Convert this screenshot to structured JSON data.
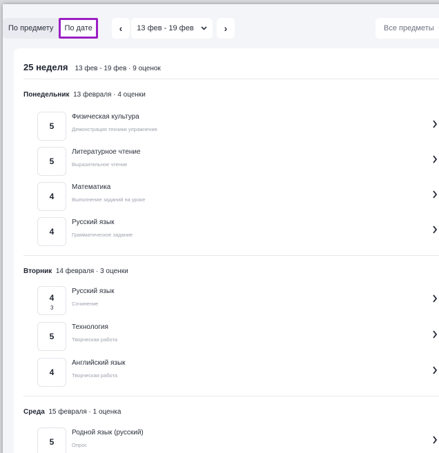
{
  "toolbar": {
    "by_subject": "По предмету",
    "by_date": "По дате",
    "prev": "‹",
    "next": "›",
    "date_range": "13 фев - 19 фев",
    "date_dropdown_icon": "chevron-down-icon",
    "subjects_filter": "Все предметы"
  },
  "week": {
    "title": "25 неделя",
    "meta": "13 фев - 19 фев  ·  9 оценок"
  },
  "days": [
    {
      "name": "Понедельник",
      "meta": "13 февраля  ·  4 оценки",
      "grades": [
        {
          "grade": "5",
          "subject": "Физическая культура",
          "description": "Демонстрация техники упражнения"
        },
        {
          "grade": "5",
          "subject": "Литературное чтение",
          "description": "Выразительное чтение"
        },
        {
          "grade": "4",
          "subject": "Математика",
          "description": "Выполнение заданий на уроке"
        },
        {
          "grade": "4",
          "subject": "Русский язык",
          "description": "Грамматическое задание"
        }
      ]
    },
    {
      "name": "Вторник",
      "meta": "14 февраля  ·  3 оценки",
      "grades": [
        {
          "grade": "4",
          "sub_grade": "3",
          "subject": "Русский язык",
          "description": "Сочинение"
        },
        {
          "grade": "5",
          "subject": "Технология",
          "description": "Творческая работа"
        },
        {
          "grade": "4",
          "subject": "Английский язык",
          "description": "Творческая работа"
        }
      ]
    },
    {
      "name": "Среда",
      "meta": "15 февраля  ·  1 оценка",
      "grades": [
        {
          "grade": "5",
          "subject": "Родной язык (русский)",
          "description": "Опрос"
        }
      ]
    }
  ],
  "colors": {
    "accent_highlight": "#9b1fc4",
    "background": "#f4f5f8",
    "card": "#ffffff"
  }
}
